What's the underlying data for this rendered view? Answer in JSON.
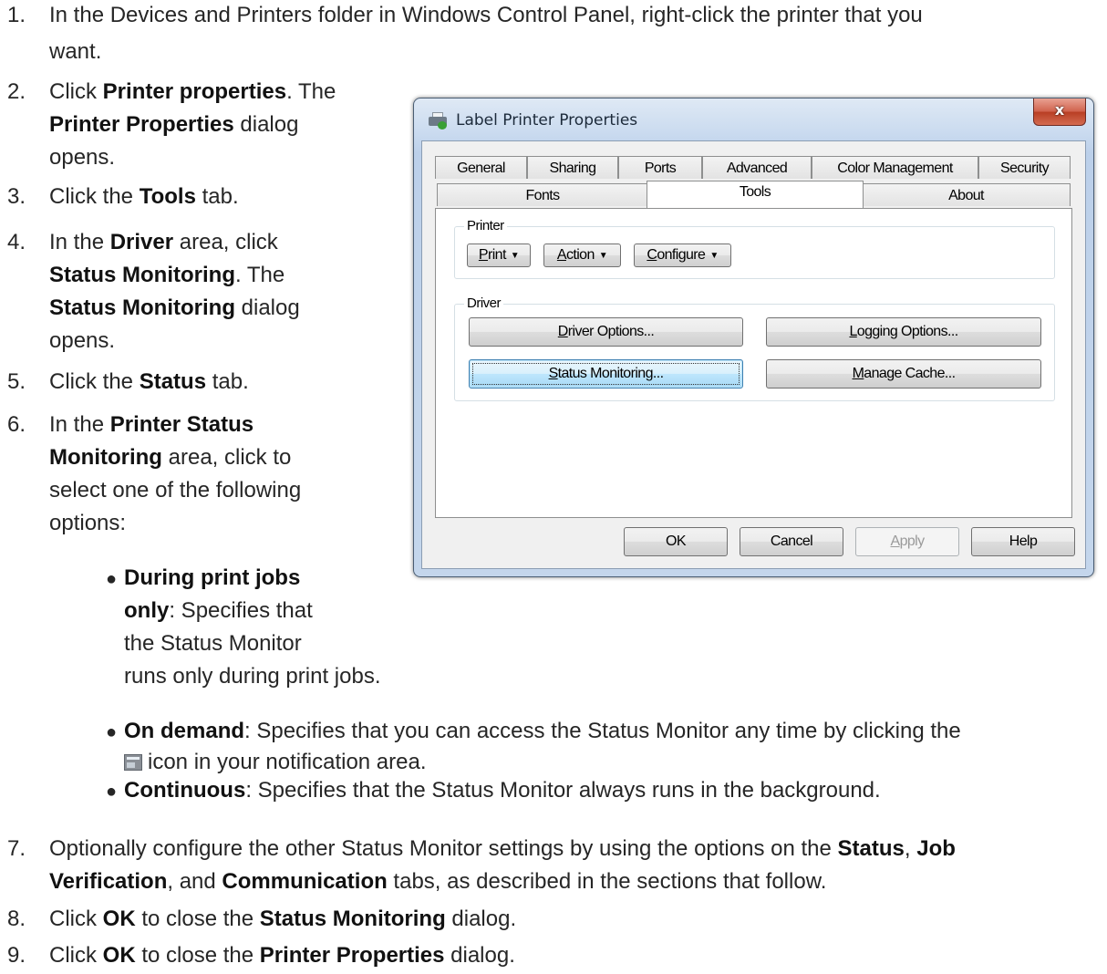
{
  "steps": [
    {
      "n": "1.",
      "parts": [
        "In the Devices and Printers folder in Windows Control Panel, right-click the printer that you",
        "want."
      ]
    },
    {
      "n": "2.",
      "a": "Click ",
      "b": "Printer properties",
      "c": ". The",
      "d": "Printer Properties",
      "e": " dialog",
      "f": "opens."
    },
    {
      "n": "3.",
      "a": "Click the ",
      "b": "Tools",
      "c": " tab."
    },
    {
      "n": "4.",
      "a": "In the ",
      "b": "Driver",
      "c": " area, click",
      "d": "Status Monitoring",
      "e": ". The",
      "f": "Status Monitoring",
      "g": " dialog",
      "h": "opens."
    },
    {
      "n": "5.",
      "a": "Click the ",
      "b": "Status",
      "c": " tab."
    },
    {
      "n": "6.",
      "a": "In the ",
      "b": "Printer Status",
      "c": "Monitoring",
      "d": " area, click to",
      "e": "select one of the following",
      "f": "options:"
    },
    {
      "n": "7.",
      "a": "Optionally configure the other Status Monitor settings by using the options on the ",
      "b": "Status",
      "c": ", ",
      "d": "Job",
      "e": "Verification",
      "f": ", and ",
      "g": "Communication",
      "h": " tabs, as described in the sections that follow."
    },
    {
      "n": "8.",
      "a": "Click ",
      "b": "OK",
      "c": " to close the ",
      "d": "Status Monitoring",
      "e": " dialog."
    },
    {
      "n": "9.",
      "a": "Click ",
      "b": "OK",
      "c": " to close the ",
      "d": "Printer Properties",
      "e": " dialog."
    }
  ],
  "bullets": [
    {
      "b1": "During print jobs",
      "b2": "only",
      "t1": ": Specifies that",
      "t2": "the Status Monitor",
      "t3": "runs only during print jobs."
    },
    {
      "b": "On demand",
      "t1": ": Specifies that you can access the Status Monitor any time by clicking the",
      "icon": "status-monitor-tray-icon",
      "t2": "icon in your notification area."
    },
    {
      "b": "Continuous",
      "t1": ": Specifies that the Status Monitor always runs in the background."
    }
  ],
  "dialog": {
    "title": "Label Printer Properties",
    "close_label": "x",
    "tabs_back": [
      "General",
      "Sharing",
      "Ports",
      "Advanced",
      "Color Management",
      "Security"
    ],
    "tabs_front": [
      "Fonts",
      "Tools",
      "About"
    ],
    "active_tab": "Tools",
    "printer_group": {
      "label": "Printer",
      "buttons": [
        {
          "access": "P",
          "rest": "rint"
        },
        {
          "access": "A",
          "rest": "ction"
        },
        {
          "access": "C",
          "rest": "onfigure"
        }
      ]
    },
    "driver_group": {
      "label": "Driver",
      "driver_options": {
        "access": "D",
        "rest": "river Options..."
      },
      "logging_options": {
        "access": "L",
        "rest": "ogging Options..."
      },
      "status_monitoring": {
        "access": "S",
        "rest": "tatus Monitoring..."
      },
      "manage_cache": {
        "access": "M",
        "rest": "anage Cache..."
      }
    },
    "footer": {
      "ok": "OK",
      "cancel": "Cancel",
      "apply_access": "A",
      "apply_rest": "pply",
      "help": "Help"
    }
  }
}
